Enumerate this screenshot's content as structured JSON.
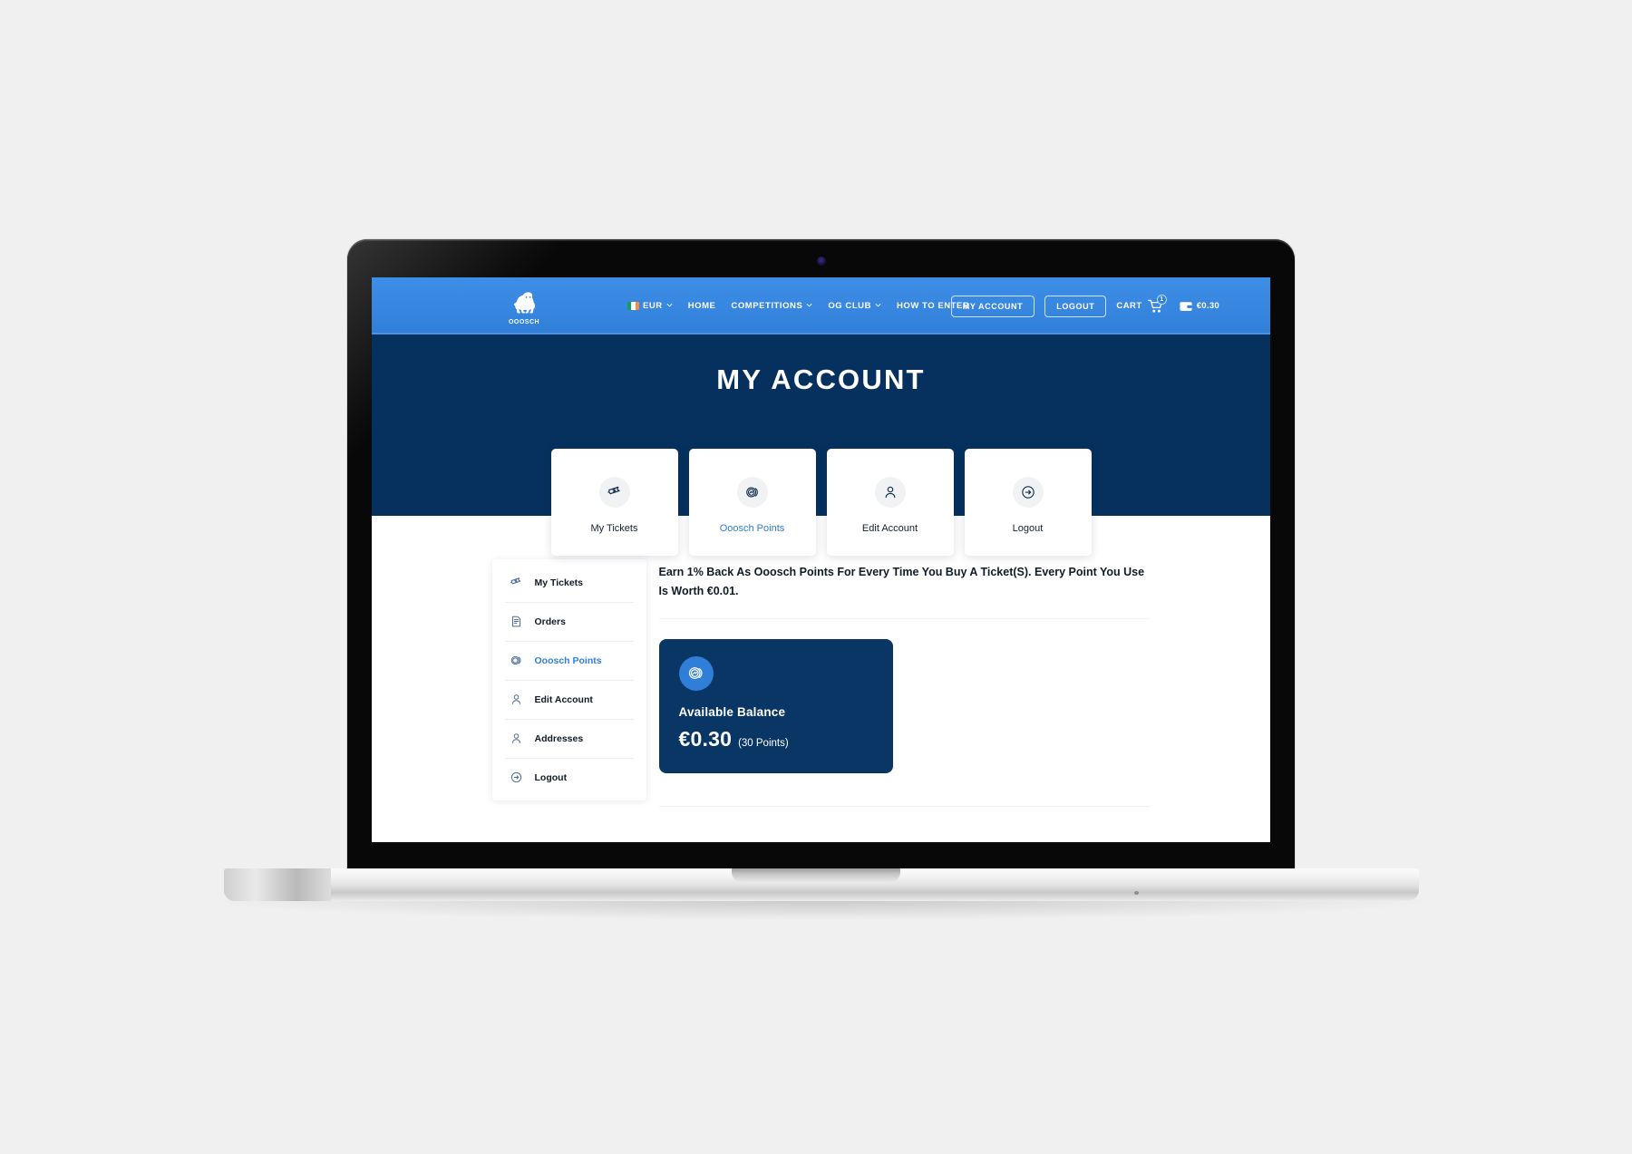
{
  "navbar": {
    "logo_name": "ooosch-gorilla-logo",
    "logo_word": "OOOSCH",
    "currency": "EUR",
    "links": [
      {
        "label": "HOME",
        "has_caret": false
      },
      {
        "label": "COMPETITIONS",
        "has_caret": true
      },
      {
        "label": "OG CLUB",
        "has_caret": true
      },
      {
        "label": "HOW TO ENTER",
        "has_caret": false
      }
    ],
    "my_account_label": "MY ACCOUNT",
    "logout_label": "LOGOUT",
    "cart_label": "CART",
    "cart_count": "1",
    "wallet_amount": "€0.30"
  },
  "hero": {
    "title": "MY ACCOUNT",
    "cards": [
      {
        "label": "My Tickets",
        "icon": "ticket-icon",
        "active": false
      },
      {
        "label": "Ooosch Points",
        "icon": "coins-icon",
        "active": true
      },
      {
        "label": "Edit Account",
        "icon": "user-icon",
        "active": false
      },
      {
        "label": "Logout",
        "icon": "logout-arrow-icon",
        "active": false
      }
    ]
  },
  "sidebar": {
    "items": [
      {
        "label": "My Tickets",
        "icon": "ticket-icon",
        "active": false
      },
      {
        "label": "Orders",
        "icon": "orders-document-icon",
        "active": false
      },
      {
        "label": "Ooosch Points",
        "icon": "coins-icon",
        "active": true
      },
      {
        "label": "Edit Account",
        "icon": "user-icon",
        "active": false
      },
      {
        "label": "Addresses",
        "icon": "user-icon",
        "active": false
      },
      {
        "label": "Logout",
        "icon": "logout-arrow-icon",
        "active": false
      }
    ]
  },
  "main": {
    "intro": "Earn 1% Back As Ooosch Points For Every Time You Buy A Ticket(S). Every Point You Use Is Worth €0.01.",
    "balance": {
      "icon": "coins-icon",
      "label": "Available Balance",
      "amount": "€0.30",
      "points": "(30 Points)"
    }
  },
  "colors": {
    "nav_blue": "#3786e0",
    "hero_navy": "#06315f",
    "accent_blue": "#2f7ed8",
    "card_navy": "#0a3665",
    "page_bg": "#f0f0f0"
  }
}
